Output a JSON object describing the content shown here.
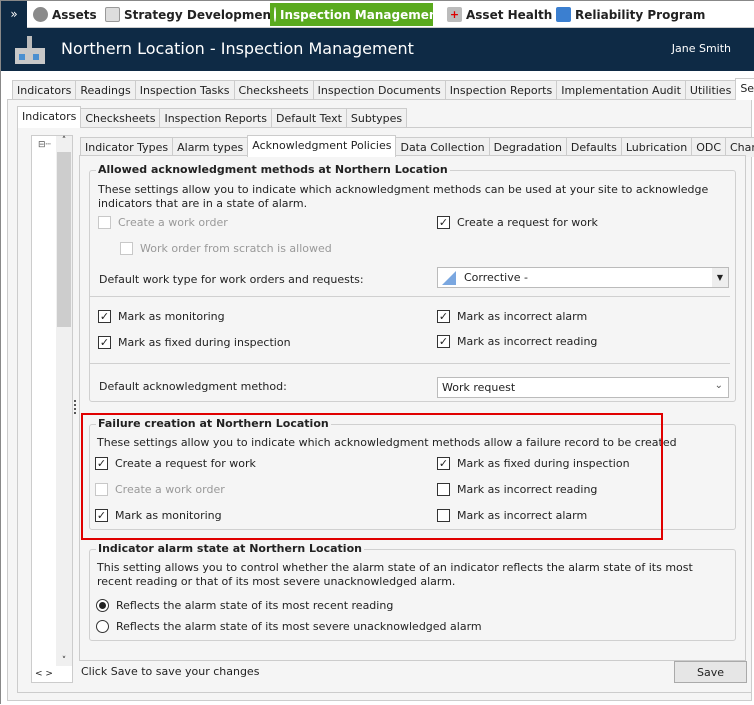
{
  "topnav": {
    "items": [
      {
        "label": "Assets"
      },
      {
        "label": "Strategy Development"
      },
      {
        "label": "Inspection Management"
      },
      {
        "label": "Asset Health"
      },
      {
        "label": "Reliability Program"
      }
    ],
    "accent": "#5aaa1e",
    "expand_icon": "double-chevron-down-icon"
  },
  "header": {
    "title": "Northern Location - Inspection Management",
    "user": "Jane Smith"
  },
  "main_tabs": [
    "Indicators",
    "Readings",
    "Inspection Tasks",
    "Checksheets",
    "Inspection Documents",
    "Inspection Reports",
    "Implementation Audit",
    "Utilities",
    "Settings"
  ],
  "sub_tabs": [
    "Indicators",
    "Checksheets",
    "Inspection Reports",
    "Default Text",
    "Subtypes"
  ],
  "inner_tabs": [
    "Indicator Types",
    "Alarm types",
    "Acknowledgment Policies",
    "Data Collection",
    "Degradation",
    "Defaults",
    "Lubrication",
    "ODC",
    "Charts"
  ],
  "allowed": {
    "title": "Allowed acknowledgment methods at Northern Location",
    "desc": "These settings allow you to indicate which acknowledgment methods can be used at your site to acknowledge indicators that are in a state of alarm.",
    "create_wo": "Create a work order",
    "wo_scratch": "Work order from scratch is allowed",
    "create_rfw": "Create a request for work",
    "work_type_label": "Default work type for work orders and requests:",
    "work_type_value": "Corrective -",
    "mark_monitoring": "Mark as monitoring",
    "mark_fixed": "Mark as fixed during inspection",
    "mark_incorrect_alarm": "Mark as incorrect alarm",
    "mark_incorrect_reading": "Mark as incorrect reading",
    "default_method_label": "Default acknowledgment method:",
    "default_method_value": "Work request"
  },
  "failure": {
    "title": "Failure creation at Northern Location",
    "desc": "These settings allow you to indicate which acknowledgment methods allow a failure record to be created",
    "create_rfw": "Create a request for work",
    "create_wo": "Create a work order",
    "mark_monitoring": "Mark as monitoring",
    "mark_fixed": "Mark as fixed during inspection",
    "mark_incorrect_reading": "Mark as incorrect reading",
    "mark_incorrect_alarm": "Mark as incorrect alarm",
    "highlight_color": "#e00000"
  },
  "alarm_state": {
    "title": "Indicator alarm state at Northern Location",
    "desc": "This setting allows you to control whether the alarm state of an indicator reflects the alarm state of its most recent reading or that of its most severe unacknowledged alarm.",
    "opt_recent": "Reflects the alarm state of its most recent reading",
    "opt_severe": "Reflects the alarm state of its most severe unacknowledged alarm"
  },
  "footer": {
    "hint": "Click Save to save your changes",
    "save": "Save"
  }
}
